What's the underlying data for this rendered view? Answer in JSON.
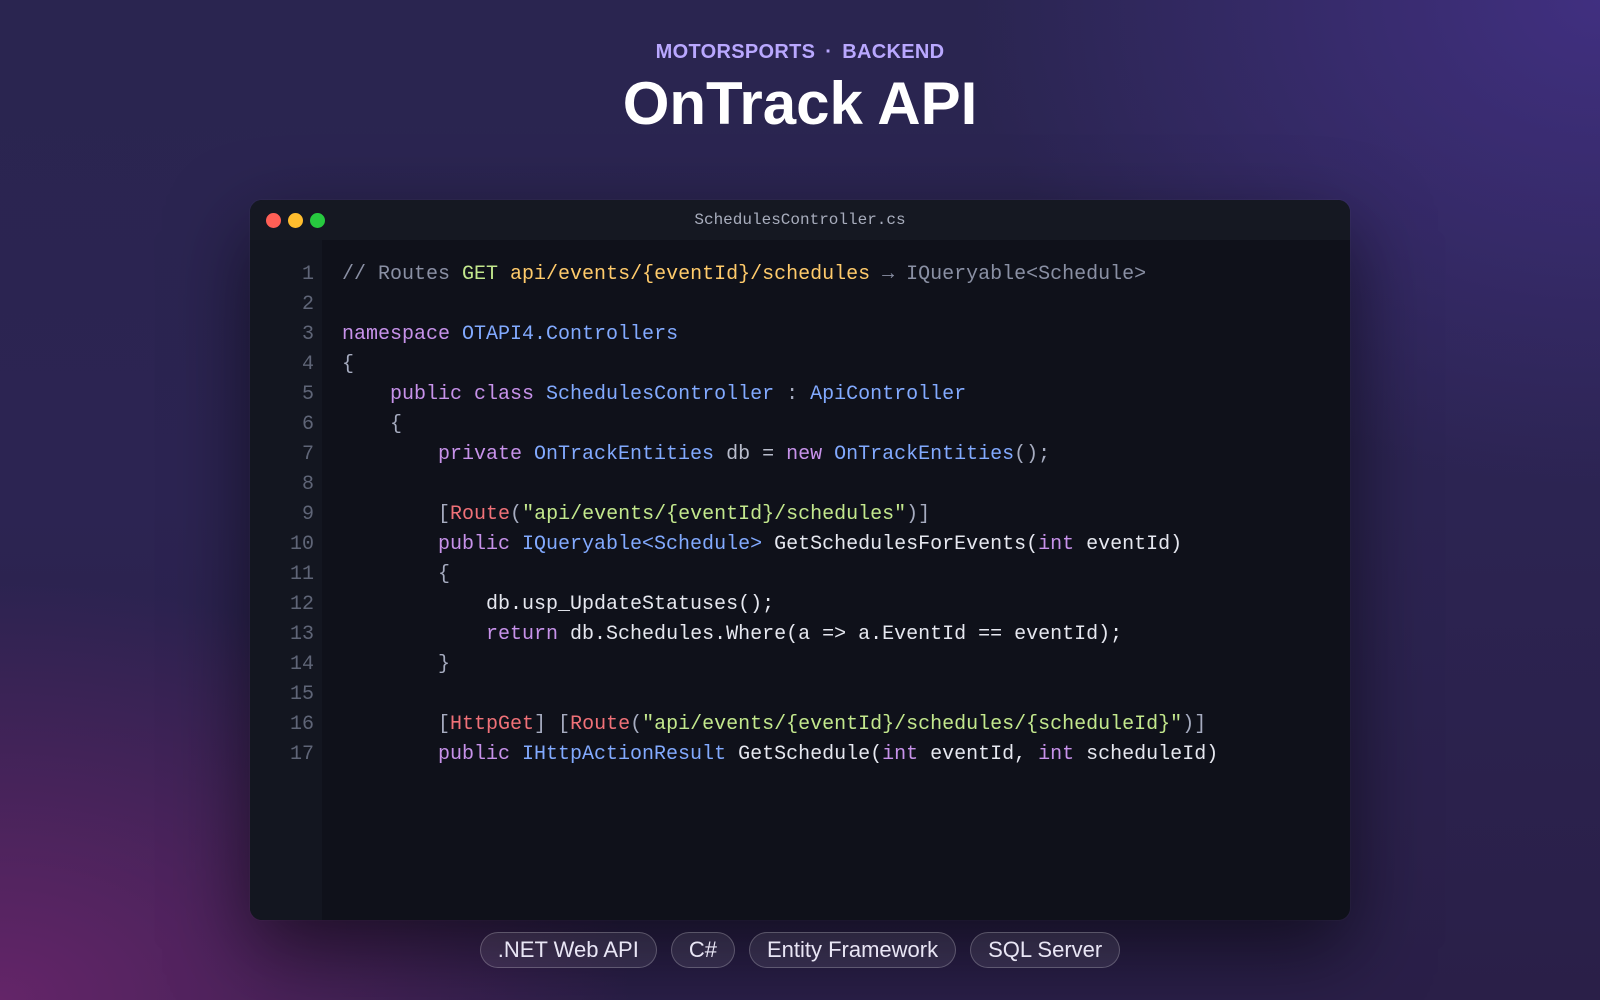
{
  "header": {
    "kicker_left": "MOTORSPORTS",
    "kicker_sep": "·",
    "kicker_right": "BACKEND",
    "title": "OnTrack API"
  },
  "window": {
    "filename": "SchedulesController.cs",
    "line_numbers": [
      "1",
      "2",
      "3",
      "4",
      "5",
      "6",
      "7",
      "8",
      "9",
      "10",
      "11",
      "12",
      "13",
      "14",
      "15",
      "16",
      "17"
    ],
    "lines": [
      [
        [
          "comment",
          "// Routes "
        ],
        [
          "get",
          "GET "
        ],
        [
          "path",
          "api/events/{eventId}/schedules"
        ],
        [
          "comment",
          " → IQueryable<Schedule>"
        ]
      ],
      [],
      [
        [
          "kw",
          "namespace "
        ],
        [
          "type",
          "OTAPI4.Controllers"
        ]
      ],
      [
        [
          "punct",
          "{"
        ]
      ],
      [
        [
          "plain",
          "    "
        ],
        [
          "kw",
          "public class "
        ],
        [
          "type",
          "SchedulesController"
        ],
        [
          "punct",
          " : "
        ],
        [
          "type",
          "ApiController"
        ]
      ],
      [
        [
          "plain",
          "    "
        ],
        [
          "punct",
          "{"
        ]
      ],
      [
        [
          "plain",
          "        "
        ],
        [
          "kw",
          "private "
        ],
        [
          "type",
          "OnTrackEntities"
        ],
        [
          "dim",
          " db = "
        ],
        [
          "kw",
          "new "
        ],
        [
          "type",
          "OnTrackEntities"
        ],
        [
          "punct",
          "();"
        ]
      ],
      [],
      [
        [
          "plain",
          "        "
        ],
        [
          "punct",
          "["
        ],
        [
          "attr",
          "Route"
        ],
        [
          "punct",
          "("
        ],
        [
          "str",
          "\"api/events/{eventId}/schedules\""
        ],
        [
          "punct",
          ")]"
        ]
      ],
      [
        [
          "plain",
          "        "
        ],
        [
          "kw",
          "public "
        ],
        [
          "type",
          "IQueryable<Schedule> "
        ],
        [
          "plain",
          "GetSchedulesForEvents("
        ],
        [
          "kw",
          "int "
        ],
        [
          "plain",
          "eventId)"
        ]
      ],
      [
        [
          "plain",
          "        "
        ],
        [
          "punct",
          "{"
        ]
      ],
      [
        [
          "plain",
          "            db.usp_UpdateStatuses();"
        ]
      ],
      [
        [
          "plain",
          "            "
        ],
        [
          "kw",
          "return "
        ],
        [
          "plain",
          "db.Schedules.Where(a => a.EventId == eventId);"
        ]
      ],
      [
        [
          "plain",
          "        "
        ],
        [
          "punct",
          "}"
        ]
      ],
      [],
      [
        [
          "plain",
          "        "
        ],
        [
          "punct",
          "["
        ],
        [
          "attr",
          "HttpGet"
        ],
        [
          "punct",
          "] ["
        ],
        [
          "attr",
          "Route"
        ],
        [
          "punct",
          "("
        ],
        [
          "str",
          "\"api/events/{eventId}/schedules/{scheduleId}\""
        ],
        [
          "punct",
          ")]"
        ]
      ],
      [
        [
          "plain",
          "        "
        ],
        [
          "kw",
          "public "
        ],
        [
          "type",
          "IHttpActionResult "
        ],
        [
          "plain",
          "GetSchedule("
        ],
        [
          "kw",
          "int "
        ],
        [
          "plain",
          "eventId, "
        ],
        [
          "kw",
          "int "
        ],
        [
          "plain",
          "scheduleId)"
        ]
      ]
    ]
  },
  "tags": [
    ".NET Web API",
    "C#",
    "Entity Framework",
    "SQL Server"
  ],
  "colors": {
    "comment": "#8a90a4",
    "keyword": "#c792ea",
    "type": "#82aaff",
    "string": "#c3e88d",
    "attribute": "#f07178",
    "path": "#ffcb6b"
  }
}
